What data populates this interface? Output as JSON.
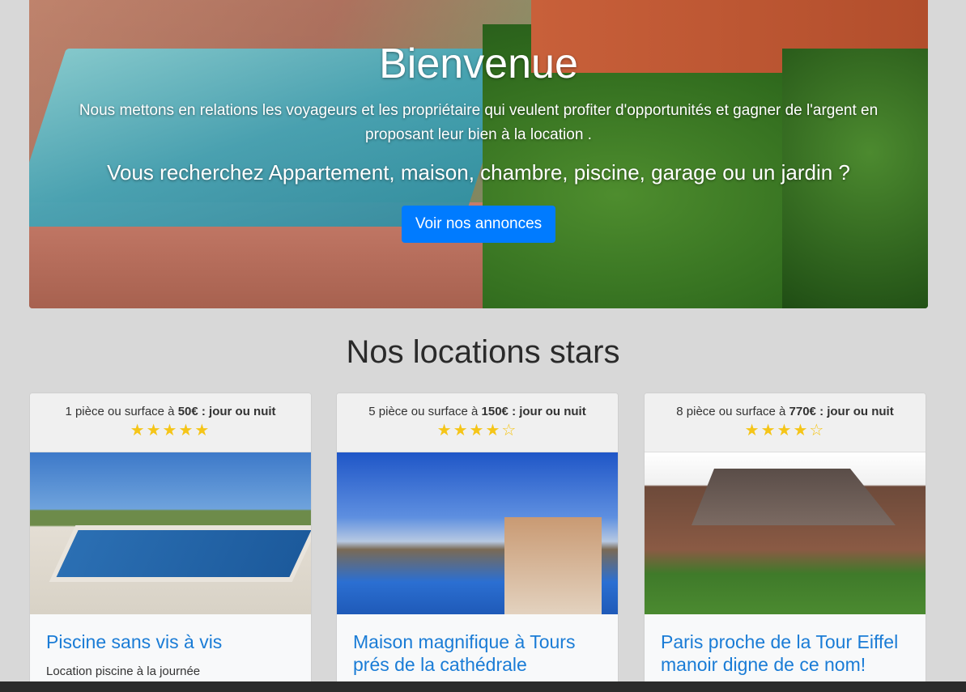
{
  "hero": {
    "title": "Bienvenue",
    "lead": "Nous mettons en relations les voyageurs et les propriétaire qui veulent profiter d'opportunités et gagner de l'argent en proposant leur bien à la location .",
    "question": "Vous recherchez Appartement, maison, chambre, piscine, garage ou un jardin ?",
    "button_label": "Voir nos annonces"
  },
  "section": {
    "title": "Nos locations stars"
  },
  "cards": [
    {
      "price_prefix": "1 pièce ou surface à ",
      "price_bold": "50€ : jour ou nuit",
      "rating": 5,
      "stars": "★★★★★",
      "title": "Piscine sans vis à vis",
      "text": "Location piscine à la journée"
    },
    {
      "price_prefix": "5 pièce ou surface à ",
      "price_bold": "150€ : jour ou nuit",
      "rating": 4,
      "stars": "★★★★☆",
      "title": "Maison magnifique à Tours prés de la cathédrale",
      "text": ""
    },
    {
      "price_prefix": "8 pièce ou surface à ",
      "price_bold": "770€ : jour ou nuit",
      "rating": 4,
      "stars": "★★★★☆",
      "title": "Paris proche de la Tour Eiffel manoir digne de ce nom!",
      "text": ""
    }
  ],
  "colors": {
    "accent": "#007bff",
    "link": "#1a7cd6",
    "star": "#f5c518"
  }
}
